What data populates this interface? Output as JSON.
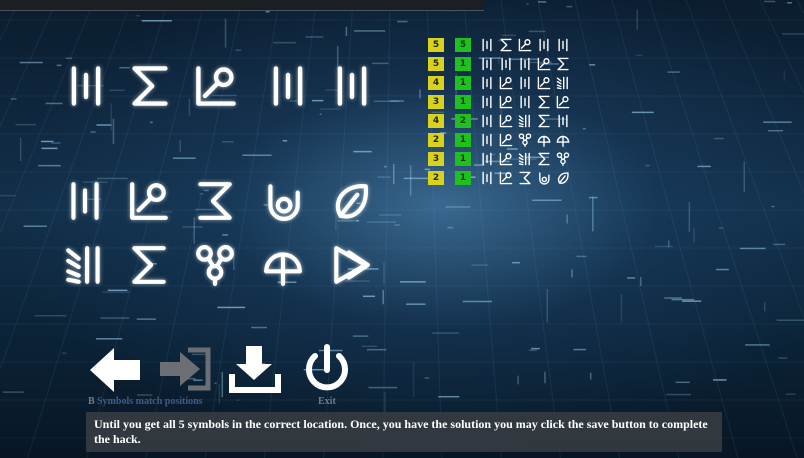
{
  "toolbar": {
    "back_label": "B",
    "faded_caption": "Symbols match positions",
    "exit_label": "Exit"
  },
  "message": "Until you get all 5 symbols in the correct location. Once, you have the solution you may click the save button to complete the hack.",
  "icons": {
    "back": "left-arrow-icon",
    "reset": "forward-into-box-icon",
    "save": "download-icon",
    "exit": "power-icon"
  },
  "board": {
    "target_row": [
      "bars3",
      "sigma",
      "key",
      "bars3",
      "bars3"
    ],
    "palette_row1": [
      "bars3",
      "key",
      "reverse-sigma",
      "eye",
      "leaf"
    ],
    "palette_row2": [
      "slash-bars",
      "sigma",
      "triple-circle",
      "half-circle",
      "double-chevron"
    ]
  },
  "history": {
    "headers": [],
    "rows": [
      {
        "yellow": "5",
        "green": "5",
        "symbols": [
          "bars3",
          "sigma",
          "key",
          "bars3",
          "bars3"
        ]
      },
      {
        "yellow": "5",
        "green": "1",
        "symbols": [
          "bars3",
          "bars3",
          "bars3",
          "key",
          "sigma"
        ]
      },
      {
        "yellow": "4",
        "green": "1",
        "symbols": [
          "bars3",
          "key",
          "bars3",
          "key",
          "slash-bars"
        ]
      },
      {
        "yellow": "3",
        "green": "1",
        "symbols": [
          "bars3",
          "key",
          "bars3",
          "sigma",
          "key"
        ]
      },
      {
        "yellow": "4",
        "green": "2",
        "symbols": [
          "bars3",
          "key",
          "slash-bars",
          "sigma",
          "bars3"
        ]
      },
      {
        "yellow": "2",
        "green": "1",
        "symbols": [
          "bars3",
          "key",
          "triple-circle",
          "half-circle",
          "half-circle"
        ]
      },
      {
        "yellow": "3",
        "green": "1",
        "symbols": [
          "bars3",
          "key",
          "slash-bars",
          "sigma",
          "triple-circle"
        ]
      },
      {
        "yellow": "2",
        "green": "1",
        "symbols": [
          "bars3",
          "key",
          "reverse-sigma",
          "eye",
          "leaf"
        ]
      }
    ]
  },
  "colors": {
    "yellow_badge": "#d8d21e",
    "green_badge": "#1fc01f",
    "message_bg": "#373c42",
    "symbol_stroke": "#ffffff"
  }
}
